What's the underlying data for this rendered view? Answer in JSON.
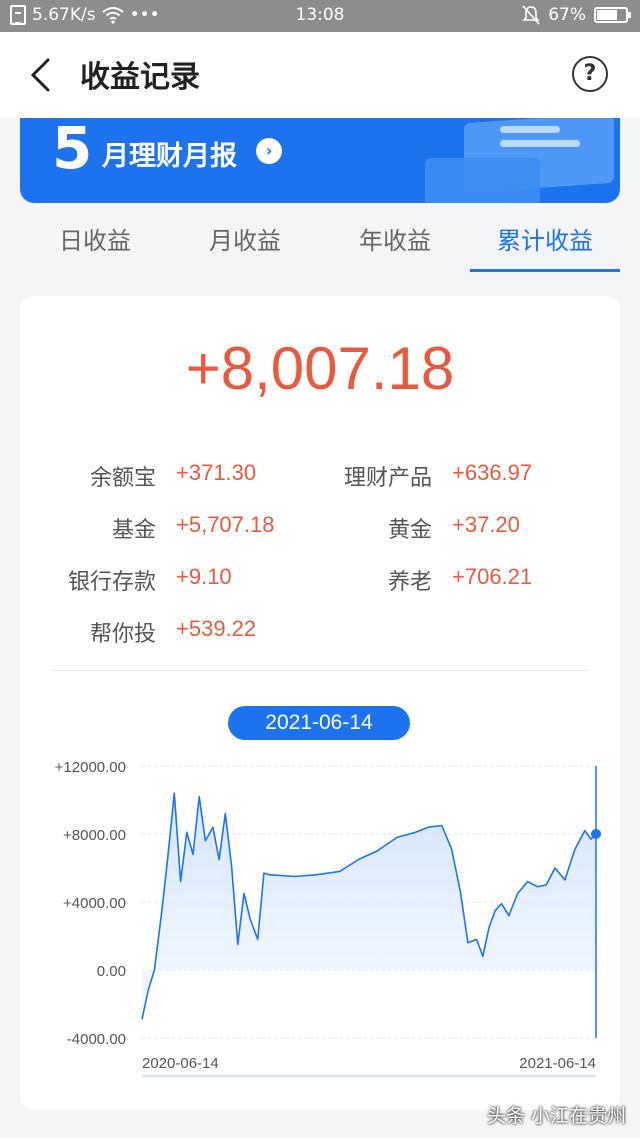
{
  "status_bar": {
    "speed": "5.67K/s",
    "dots": "•••",
    "time": "13:08",
    "battery": "67%"
  },
  "nav": {
    "title": "收益记录",
    "help_icon": "?"
  },
  "banner": {
    "month_num": "5",
    "text": "月理财月报",
    "arrow": "›"
  },
  "tabs": [
    {
      "label": "日收益",
      "active": false
    },
    {
      "label": "月收益",
      "active": false
    },
    {
      "label": "年收益",
      "active": false
    },
    {
      "label": "累计收益",
      "active": true
    }
  ],
  "summary": {
    "total": "+8,007.18",
    "items": [
      {
        "label": "余额宝",
        "value": "+371.30"
      },
      {
        "label": "理财产品",
        "value": "+636.97"
      },
      {
        "label": "基金",
        "value": "+5,707.18"
      },
      {
        "label": "黄金",
        "value": "+37.20"
      },
      {
        "label": "银行存款",
        "value": "+9.10"
      },
      {
        "label": "养老",
        "value": "+706.21"
      },
      {
        "label": "帮你投",
        "value": "+539.22"
      }
    ]
  },
  "selected_date": "2021-06-14",
  "chart_data": {
    "type": "area",
    "title": "",
    "ylim": [
      -4000,
      12000
    ],
    "yticks": [
      "+12000.00",
      "+8000.00",
      "+4000.00",
      "0.00",
      "-4000.00"
    ],
    "xticks": [
      "2020-06-14",
      "2021-06-14"
    ],
    "x": [
      "2020-06-14",
      "2020-06-19",
      "2020-06-24",
      "2020-06-30",
      "2020-07-05",
      "2020-07-10",
      "2020-07-15",
      "2020-07-20",
      "2020-07-25",
      "2020-07-30",
      "2020-08-04",
      "2020-08-10",
      "2020-08-15",
      "2020-08-20",
      "2020-08-25",
      "2020-08-30",
      "2020-09-04",
      "2020-09-09",
      "2020-09-15",
      "2020-09-20",
      "2020-09-25",
      "2020-10-15",
      "2020-11-01",
      "2020-11-20",
      "2020-12-05",
      "2020-12-20",
      "2021-01-05",
      "2021-01-20",
      "2021-01-30",
      "2021-02-10",
      "2021-02-18",
      "2021-02-25",
      "2021-03-03",
      "2021-03-10",
      "2021-03-15",
      "2021-03-20",
      "2021-03-25",
      "2021-03-30",
      "2021-04-05",
      "2021-04-12",
      "2021-04-20",
      "2021-04-28",
      "2021-05-05",
      "2021-05-12",
      "2021-05-20",
      "2021-05-28",
      "2021-06-05",
      "2021-06-10",
      "2021-06-14"
    ],
    "series": [
      {
        "values": [
          -2900,
          -1200,
          0,
          3500,
          6800,
          10400,
          5200,
          8100,
          6800,
          10200,
          7600,
          8400,
          6500,
          9200,
          6100,
          1500,
          4500,
          3000,
          1800,
          5700,
          5600,
          5500,
          5600,
          5800,
          6500,
          7000,
          7800,
          8100,
          8400,
          8500,
          7100,
          4600,
          1600,
          1800,
          800,
          2500,
          3500,
          3900,
          3200,
          4500,
          5200,
          4900,
          5000,
          6000,
          5300,
          7100,
          8200,
          7700,
          8000
        ]
      }
    ]
  }
}
